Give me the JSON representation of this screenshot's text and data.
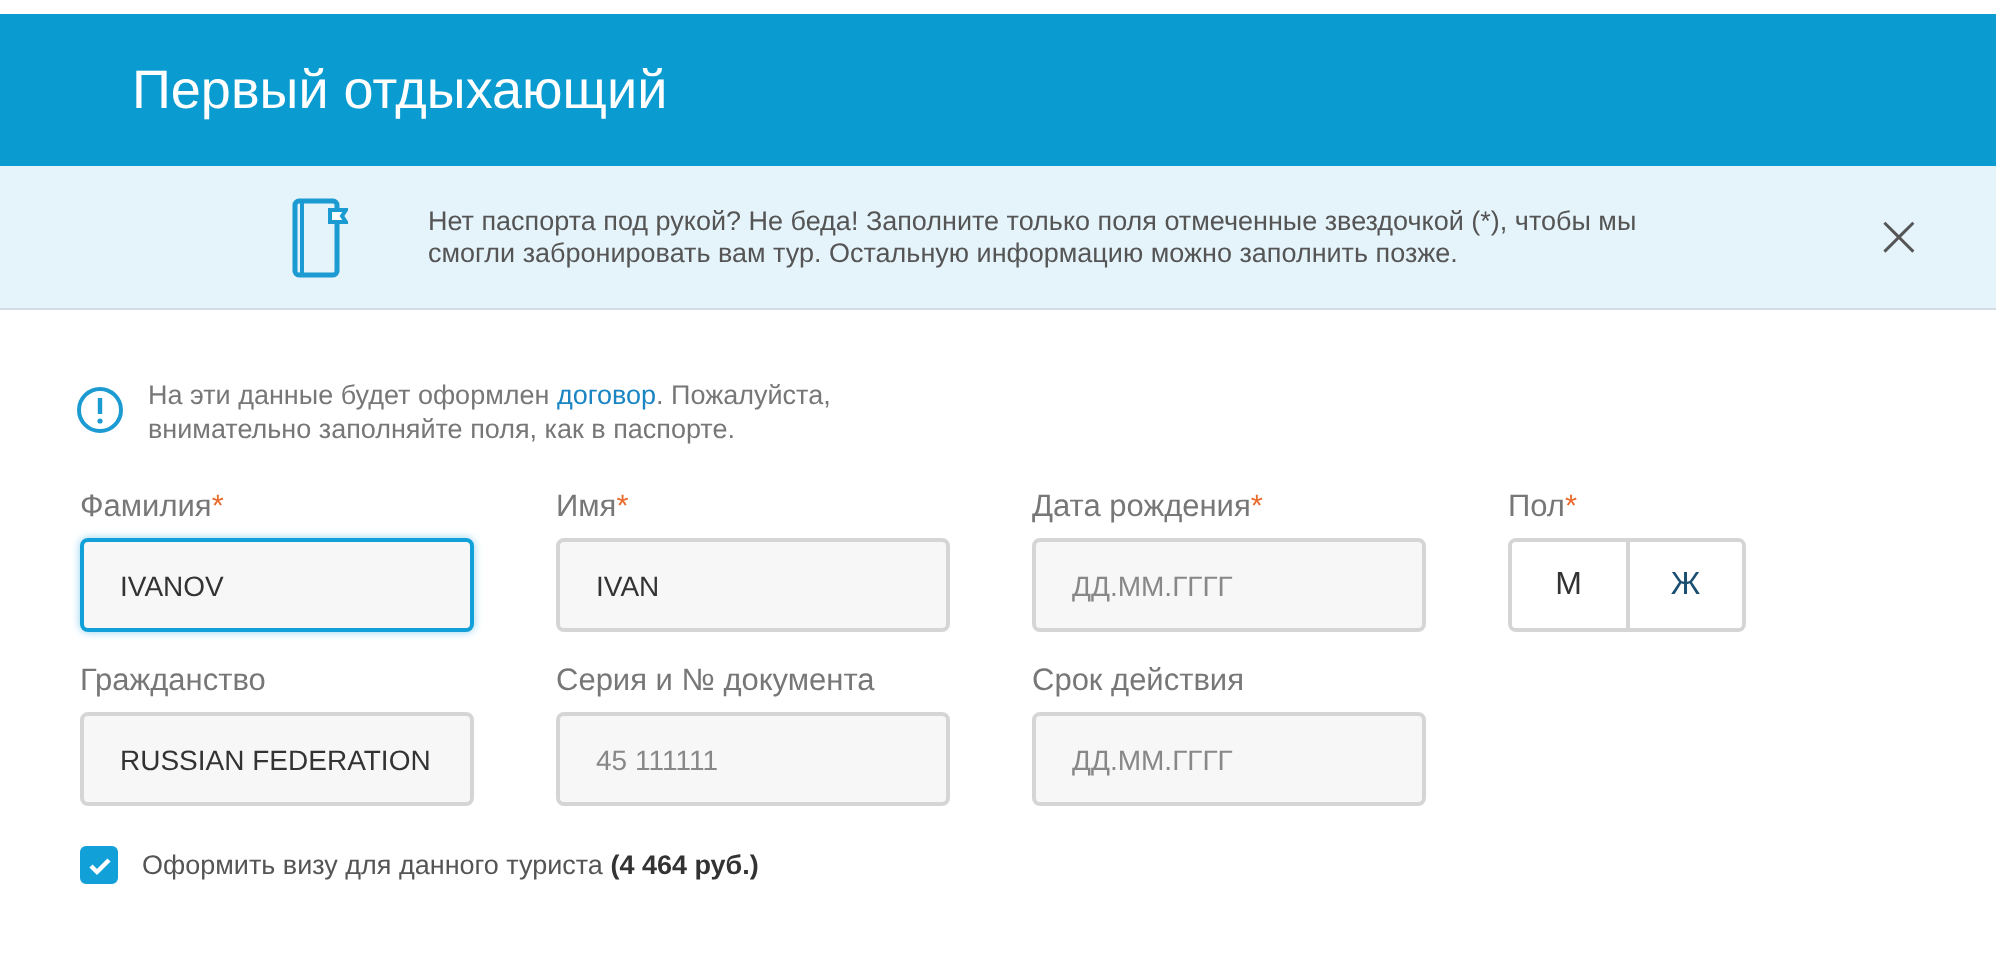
{
  "header": {
    "title": "Первый отдыхающий"
  },
  "notice": {
    "text": "Нет паспорта под рукой? Не беда! Заполните только поля отмеченные звездочкой (*), чтобы мы смогли забронировать вам тур. Остальную информацию можно заполнить позже.",
    "close": "×"
  },
  "info": {
    "text_before": "На эти данные будет оформлен ",
    "link": "договор",
    "text_after": ". Пожалуйста, внимательно заполняйте поля, как в паспорте."
  },
  "fields": [
    {
      "kind": "text",
      "label": "Фамилия",
      "required_mark": "*",
      "value": "IVANOV",
      "focused": true
    },
    {
      "kind": "text",
      "label": "Имя",
      "required_mark": "*",
      "value": "IVAN",
      "focused": false
    },
    {
      "kind": "text",
      "label": "Дата рождения",
      "required_mark": "*",
      "placeholder": "ДД.ММ.ГГГГ",
      "focused": false
    },
    {
      "kind": "segmented",
      "label": "Пол",
      "required_mark": "*",
      "options": [
        {
          "label": "М",
          "selected": false
        },
        {
          "label": "Ж",
          "selected": false
        }
      ]
    },
    {
      "kind": "text",
      "label": "Гражданство",
      "value": "RUSSIAN FEDERATION",
      "focused": false
    },
    {
      "kind": "text",
      "label": "Серия и № документа",
      "placeholder": "45 111111",
      "focused": false
    },
    {
      "kind": "text",
      "label": "Срок действия",
      "placeholder": "ДД.ММ.ГГГГ",
      "focused": false
    }
  ],
  "visa": {
    "checked": true,
    "label": "Оформить визу для данного туриста **(4 464 руб.)**"
  }
}
